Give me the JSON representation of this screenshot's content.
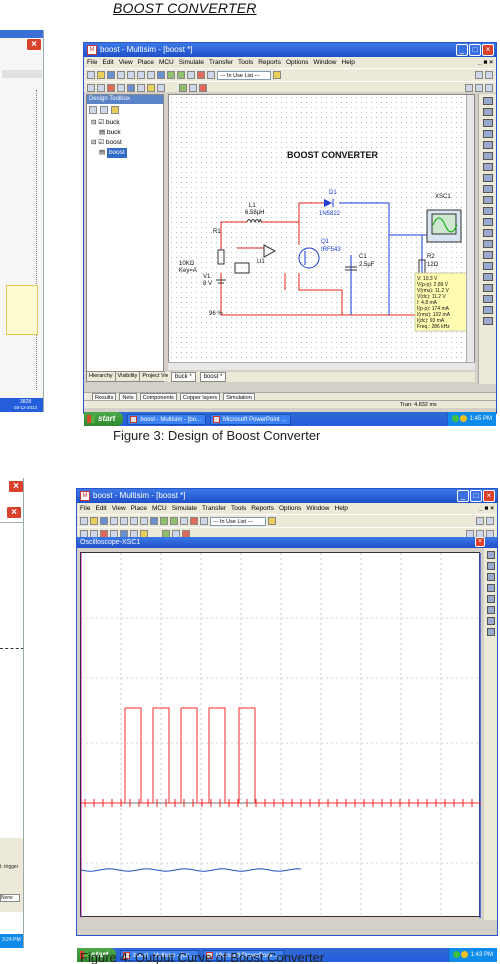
{
  "document": {
    "title": "BOOST CONVERTER",
    "figure3_caption": "Figure 3: Design of Boost Converter",
    "figure4_caption": "Figure 4: Output Curve of Boost Converter"
  },
  "left_fragments": {
    "top": {
      "lines": [
        "3828",
        "03-12-2013"
      ]
    },
    "bottom": {
      "lines": [
        "t. trigger",
        "None",
        "3:24 PM"
      ]
    }
  },
  "window1": {
    "title": "boost - Multisim - [boost *]",
    "menu": [
      "File",
      "Edit",
      "View",
      "Place",
      "MCU",
      "Simulate",
      "Transfer",
      "Tools",
      "Reports",
      "Options",
      "Window",
      "Help"
    ],
    "inuse_dropdown": "--- In Use List ---",
    "design_toolbox": {
      "header": "Design Toolbox",
      "tree": [
        "buck",
        "buck",
        "boost",
        "boost"
      ],
      "tabs": [
        "Hierarchy",
        "Visibility",
        "Project View"
      ]
    },
    "schematic": {
      "title": "BOOST CONVERTER",
      "labels": {
        "L1": "L1",
        "L1_val": "6.58µH",
        "D1": "D1",
        "D1_val": "1N5822",
        "Q1": "Q1",
        "Q1_val": "IRF543",
        "R1": "R1",
        "R1_val1": "10KΩ",
        "R1_val2": "Key=A",
        "U1": "U1",
        "V1": "V1",
        "V1_val": "8 V",
        "C1": "C1",
        "C1_val": "2.5µF",
        "R2": "R2",
        "R2_val": "12Ω",
        "XSC1": "XSC1",
        "percent": "96 %"
      },
      "readout": [
        "V: 10.3 V",
        "V(p-p): 2.89 V",
        "V(rms): 11.2 V",
        "V(dc): 11.2 V",
        "I: 4.8 mA",
        "I(p-p): 174 mA",
        "I(rms): 102 mA",
        "I(dc): 93 mA",
        "Freq.: 286 kHz"
      ]
    },
    "sheet_tabs": [
      "buck *",
      "boost *"
    ],
    "results_tabs": [
      "Results",
      "Nets",
      "Components",
      "Copper layers",
      "Simulation"
    ],
    "status_tran": "Tran: 4.832 ms",
    "taskbar": {
      "start": "start",
      "items": [
        "boost - Multisim - [bo...",
        "Microsoft PowerPoint ..."
      ],
      "time": "1:45 PM"
    }
  },
  "window2": {
    "title": "boost - Multisim - [boost *]",
    "menu": [
      "File",
      "Edit",
      "View",
      "Place",
      "MCU",
      "Simulate",
      "Transfer",
      "Tools",
      "Reports",
      "Options",
      "Window",
      "Help"
    ],
    "inuse_dropdown": "--- In Use List ---",
    "oscilloscope_title": "Oscilloscope-XSC1",
    "taskbar": {
      "start": "start",
      "items": [
        "boost - Multisim - [bo...",
        "Microsoft PowerPoint ..."
      ],
      "time": "1:43 PM"
    }
  },
  "colors": {
    "xp_blue": "#245edb",
    "start_green": "#3c9a3a",
    "wire_red": "#e8241c",
    "wire_blue": "#1a3cd8",
    "trace_red": "#ff2a2a",
    "trace_blue": "#2050c0"
  }
}
